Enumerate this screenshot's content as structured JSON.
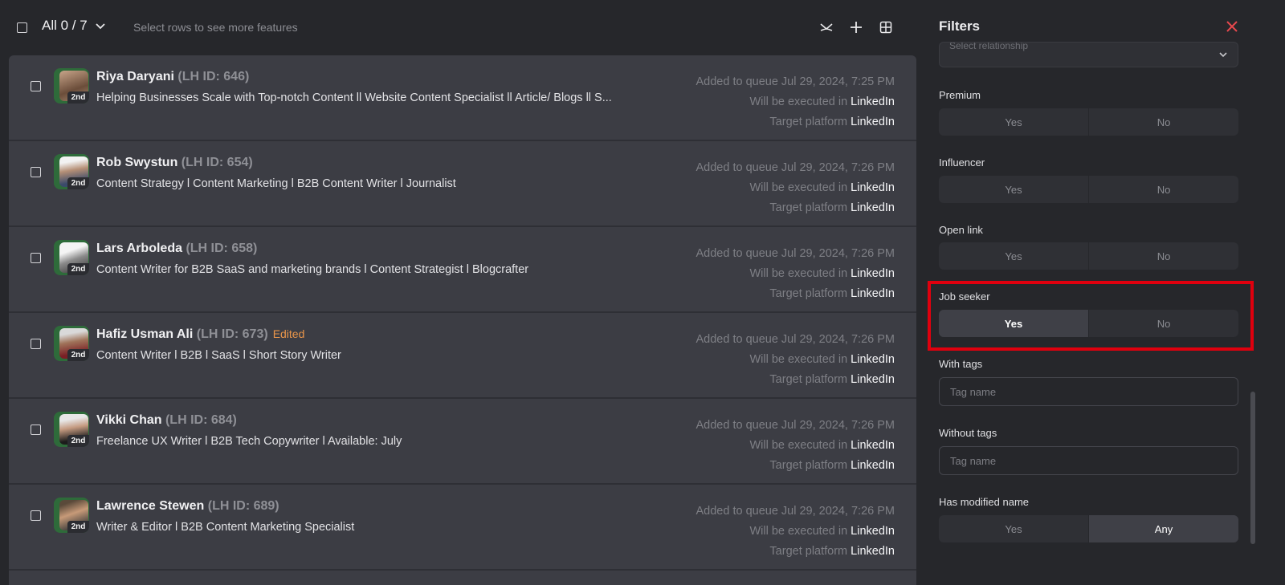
{
  "toolbar": {
    "selection_label": "All 0 / 7",
    "hint": "Select rows to see more features",
    "icons": [
      "connections-icon",
      "plus-icon",
      "grid-icon"
    ]
  },
  "rows": [
    {
      "name": "Riya Daryani",
      "lh_id": "(LH ID: 646)",
      "edited": "",
      "degree": "2nd",
      "headline": "Helping Businesses Scale with Top-notch Content ll Website Content Specialist ll Article/ Blogs ll S...",
      "added": "Added to queue Jul 29, 2024, 7:25 PM",
      "exec_label": "Will be executed in",
      "exec_value": "LinkedIn",
      "target_label": "Target platform",
      "target_value": "LinkedIn"
    },
    {
      "name": "Rob Swystun",
      "lh_id": "(LH ID: 654)",
      "edited": "",
      "degree": "2nd",
      "headline": "Content Strategy l Content Marketing l B2B Content Writer l Journalist",
      "added": "Added to queue Jul 29, 2024, 7:26 PM",
      "exec_label": "Will be executed in",
      "exec_value": "LinkedIn",
      "target_label": "Target platform",
      "target_value": "LinkedIn"
    },
    {
      "name": "Lars Arboleda",
      "lh_id": "(LH ID: 658)",
      "edited": "",
      "degree": "2nd",
      "headline": "Content Writer for B2B SaaS and marketing brands l Content Strategist l Blogcrafter",
      "added": "Added to queue Jul 29, 2024, 7:26 PM",
      "exec_label": "Will be executed in",
      "exec_value": "LinkedIn",
      "target_label": "Target platform",
      "target_value": "LinkedIn"
    },
    {
      "name": "Hafiz Usman Ali",
      "lh_id": "(LH ID: 673)",
      "edited": "Edited",
      "degree": "2nd",
      "headline": "Content Writer l B2B l SaaS l Short Story Writer",
      "added": "Added to queue Jul 29, 2024, 7:26 PM",
      "exec_label": "Will be executed in",
      "exec_value": "LinkedIn",
      "target_label": "Target platform",
      "target_value": "LinkedIn"
    },
    {
      "name": "Vikki Chan",
      "lh_id": "(LH ID: 684)",
      "edited": "",
      "degree": "2nd",
      "headline": "Freelance UX Writer l B2B Tech Copywriter l Available: July",
      "added": "Added to queue Jul 29, 2024, 7:26 PM",
      "exec_label": "Will be executed in",
      "exec_value": "LinkedIn",
      "target_label": "Target platform",
      "target_value": "LinkedIn"
    },
    {
      "name": "Lawrence Stewen",
      "lh_id": "(LH ID: 689)",
      "edited": "",
      "degree": "2nd",
      "headline": "Writer & Editor l B2B Content Marketing Specialist",
      "added": "Added to queue Jul 29, 2024, 7:26 PM",
      "exec_label": "Will be executed in",
      "exec_value": "LinkedIn",
      "target_label": "Target platform",
      "target_value": "LinkedIn"
    }
  ],
  "filters": {
    "title": "Filters",
    "relationship_placeholder": "Select relationship",
    "premium": {
      "label": "Premium",
      "yes": "Yes",
      "no": "No"
    },
    "influencer": {
      "label": "Influencer",
      "yes": "Yes",
      "no": "No"
    },
    "open_link": {
      "label": "Open link",
      "yes": "Yes",
      "no": "No"
    },
    "job_seeker": {
      "label": "Job seeker",
      "yes": "Yes",
      "no": "No",
      "selected": "Yes"
    },
    "with_tags": {
      "label": "With tags",
      "placeholder": "Tag name"
    },
    "without_tags": {
      "label": "Without tags",
      "placeholder": "Tag name"
    },
    "has_modified_name": {
      "label": "Has modified name",
      "yes": "Yes",
      "any": "Any",
      "selected": "Any"
    }
  },
  "colors": {
    "highlight": "#e0000e",
    "accent_close": "#e5484d",
    "edited": "#e9954a"
  }
}
